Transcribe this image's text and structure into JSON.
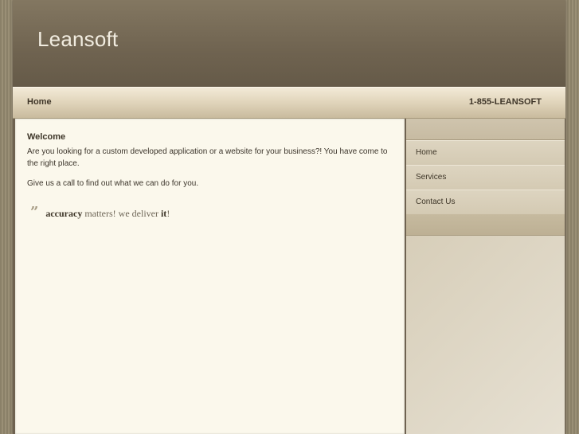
{
  "site": {
    "brand": "Leansoft"
  },
  "nav": {
    "home_label": "Home",
    "phone": "1-855-LEANSOFT"
  },
  "content": {
    "title": "Welcome",
    "para1": "Are you looking for a custom developed application or a website for your business?! You have come to the right place.",
    "para2": "Give us a call to find out what we can do for you.",
    "quote": {
      "word1": "accuracy",
      "middle": " matters! we deliver ",
      "word2": "it",
      "end": "!"
    }
  },
  "sidebar": {
    "items": [
      {
        "label": "Home"
      },
      {
        "label": "Services"
      },
      {
        "label": "Contact Us"
      }
    ]
  },
  "colors": {
    "header_bg": "#6f6350",
    "content_bg": "#fbf8ec",
    "nav_bg": "#e2d6bd"
  }
}
